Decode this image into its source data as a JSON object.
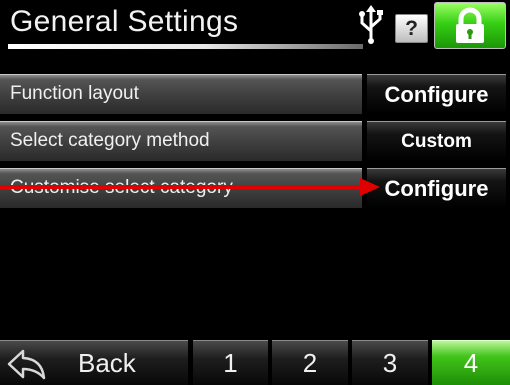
{
  "header": {
    "title": "General Settings",
    "help_label": "?",
    "icons": [
      "usb-icon",
      "help-icon",
      "lock-icon"
    ]
  },
  "settings": [
    {
      "label": "Function layout",
      "value": "Configure"
    },
    {
      "label": "Select category method",
      "value": "Custom"
    },
    {
      "label": "Customise select category",
      "value": "Configure"
    }
  ],
  "footer": {
    "back_label": "Back",
    "pages": [
      "1",
      "2",
      "3",
      "4"
    ],
    "active_page": "4"
  },
  "colors": {
    "active": "#2fb812",
    "annotation_arrow": "#e00000"
  }
}
